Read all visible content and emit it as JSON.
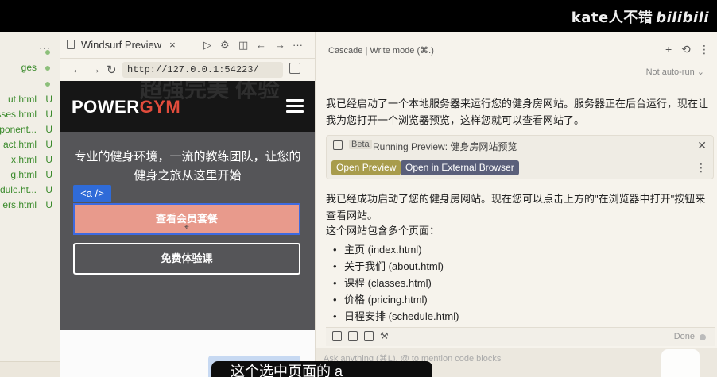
{
  "watermark": {
    "author": "kate人不错",
    "site": "bilibili"
  },
  "explorer": {
    "dots": "···",
    "files": [
      {
        "name": "",
        "status": "dot"
      },
      {
        "name": "ges",
        "status": "dot"
      },
      {
        "name": "",
        "status": "dot"
      },
      {
        "name": "ut.html",
        "status": "U"
      },
      {
        "name": "sses.html",
        "status": "U"
      },
      {
        "name": "ponent...",
        "status": "U"
      },
      {
        "name": "act.html",
        "status": "U"
      },
      {
        "name": "x.html",
        "status": "U"
      },
      {
        "name": "g.html",
        "status": "U"
      },
      {
        "name": "edule.ht...",
        "status": "U"
      },
      {
        "name": "ers.html",
        "status": "U"
      }
    ]
  },
  "preview": {
    "tab_title": "Windsurf Preview",
    "tab_close": "×",
    "url": "http://127.0.0.1:54223/",
    "site": {
      "ghost_text": "超强完美 体验",
      "logo_power": "POWER",
      "logo_gym": "GYM",
      "tagline": "专业的健身环境，一流的教练团队，让您的健身之旅从这里开始",
      "selected_tag": "<a />",
      "cta_label": "查看会员套餐",
      "trial_label": "免费体验课"
    }
  },
  "cascade": {
    "title": "Cascade | Write mode (⌘.)",
    "autorun": "Not auto-run",
    "msg1": "我已经启动了一个本地服务器来运行您的健身房网站。服务器正在后台运行，现在让我为您打开一个浏览器预览，这样您就可以查看网站了。",
    "card": {
      "beta": "Beta",
      "title": "Running Preview:  健身房网站预览",
      "open_preview": "Open Preview",
      "open_external": "Open in External Browser"
    },
    "msg2": "我已经成功启动了您的健身房网站。现在您可以点击上方的\"在浏览器中打开\"按钮来查看网站。",
    "msg3": "这个网站包含多个页面：",
    "pages": [
      "主页 (index.html)",
      "关于我们 (about.html)",
      "课程 (classes.html)",
      "价格 (pricing.html)",
      "日程安排 (schedule.html)"
    ],
    "done": "Done",
    "ask_placeholder": "Ask anything (⌘L), @ to mention code blocks"
  },
  "subtitle": "这个选中页面的 a"
}
